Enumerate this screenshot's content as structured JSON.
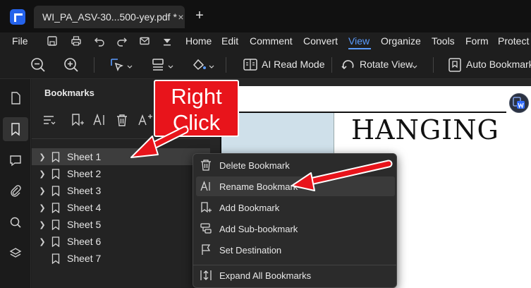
{
  "window": {
    "tab_title": "WI_PA_ASV-30...500-yey.pdf *",
    "tab_close": "×",
    "new_tab": "+"
  },
  "menu": {
    "file": "File",
    "items": [
      "Home",
      "Edit",
      "Comment",
      "Convert",
      "View",
      "Organize",
      "Tools",
      "Form",
      "Protect"
    ],
    "active": "View"
  },
  "toolbar": {
    "ai_read_mode": "AI Read Mode",
    "rotate_view": "Rotate View",
    "auto_bookmark": "Auto Bookmark"
  },
  "panel": {
    "title": "Bookmarks",
    "bookmarks": [
      "Sheet 1",
      "Sheet 2",
      "Sheet 3",
      "Sheet 4",
      "Sheet 5",
      "Sheet 6",
      "Sheet 7"
    ]
  },
  "document": {
    "heading": "HANGING"
  },
  "context_menu": {
    "items": [
      "Delete Bookmark",
      "Rename Bookmark",
      "Add Bookmark",
      "Add Sub-bookmark",
      "Set Destination",
      "Expand All Bookmarks"
    ],
    "highlighted": "Rename Bookmark"
  },
  "annotation": {
    "line1": "Right",
    "line2": "Click"
  },
  "colors": {
    "accent": "#5b9cff",
    "annotation_red": "#e8141b",
    "app_blue": "#2563eb"
  }
}
